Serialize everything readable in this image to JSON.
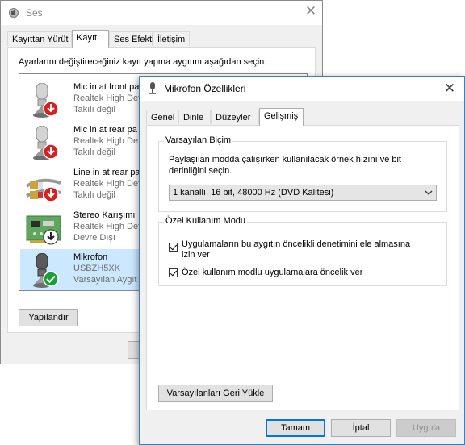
{
  "ses": {
    "title": "Ses",
    "tabs": [
      "Kayıttan Yürüt",
      "Kayıt",
      "Ses Efekti",
      "İletişim"
    ],
    "instruction": "Ayarlarını değiştireceğiniz kayıt yapma aygıtını aşağıdan seçin:",
    "devices": [
      {
        "name": "Mic in at front pa",
        "line2": "Realtek High Def",
        "status": "Takılı değil",
        "icon": "microphone-icon",
        "badge": "disconnected-down-arrow-icon"
      },
      {
        "name": "Mic in at rear pa",
        "line2": "Realtek High Def",
        "status": "Takılı değil",
        "icon": "microphone-icon",
        "badge": "disconnected-down-arrow-icon"
      },
      {
        "name": "Line in at rear pa",
        "line2": "Realtek High Def",
        "status": "Takılı değil",
        "icon": "line-in-cable-icon",
        "badge": "disconnected-down-arrow-icon"
      },
      {
        "name": "Stereo Karışımı",
        "line2": "Realtek High Def",
        "status": "Devre Dışı",
        "icon": "sound-card-icon",
        "badge": "disabled-down-arrow-icon"
      },
      {
        "name": "Mikrofon",
        "line2": "USBZH5XK",
        "status": "Varsayılan Aygıt",
        "icon": "microphone-icon",
        "badge": "default-checkmark-icon"
      }
    ],
    "configure_button": "Yapılandır"
  },
  "mikrofon": {
    "title": "Mikrofon Özellikleri",
    "tabs": [
      "Genel",
      "Dinle",
      "Düzeyler",
      "Gelişmiş"
    ],
    "default_format": {
      "legend": "Varsayılan Biçim",
      "description_line1": "Paylaşılan modda çalışırken kullanılacak örnek hızını ve bit",
      "description_line2": "derinliğini seçin.",
      "selected_value": "1 kanallı, 16 bit, 48000 Hz (DVD Kalitesi)"
    },
    "exclusive_mode": {
      "legend": "Özel Kullanım Modu",
      "option1_line1": "Uygulamaların bu aygıtın öncelikli denetimini ele almasına",
      "option1_line2": "izin ver",
      "option1_checked": true,
      "option2": "Özel kullanım modlu uygulamalara öncelik ver",
      "option2_checked": true
    },
    "restore_defaults_button": "Varsayılanları Geri Yükle",
    "ok_button": "Tamam",
    "cancel_button": "İptal",
    "apply_button": "Uygula"
  },
  "colors": {
    "selection": "#cce8ff",
    "accent": "#0078d7",
    "red_badge": "#d81e1e",
    "green_badge": "#1a9e36"
  }
}
